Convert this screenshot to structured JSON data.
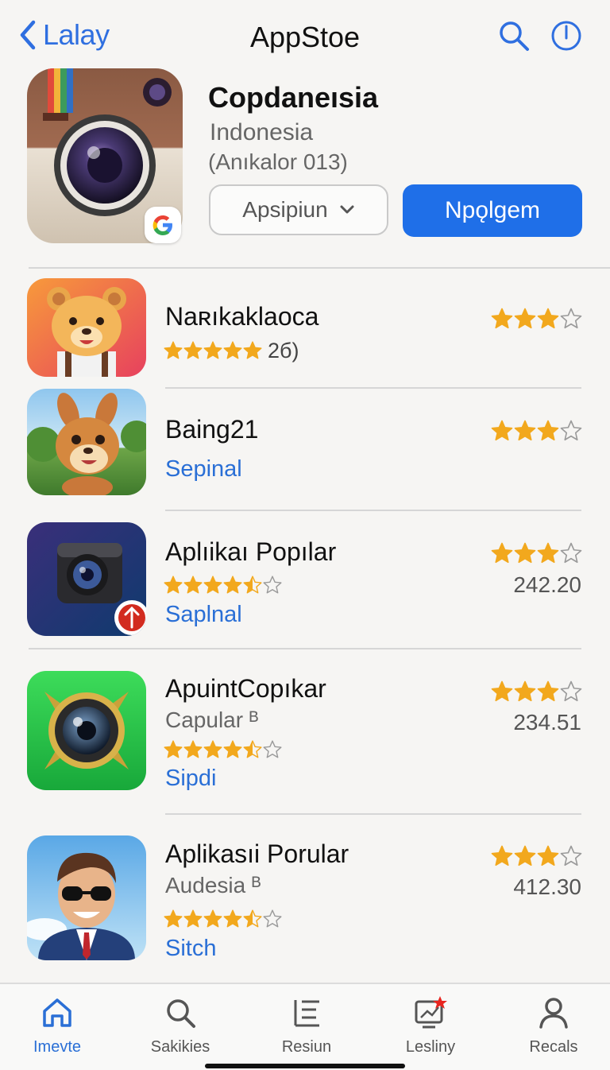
{
  "header": {
    "back_label": "Lalay",
    "title": "AppStoe"
  },
  "featured": {
    "name": "Copdaneısia",
    "country": "Indonesia",
    "meta": "(Anıkalor 013)",
    "dropdown_label": "Apsipiun",
    "primary_button": "Npǫlgem"
  },
  "apps": [
    {
      "name": "Naʀıkaklaoca",
      "left_stars": 5,
      "left_count": "2б)",
      "right_stars": 3
    },
    {
      "name": "Baing21",
      "link": "Sepinal",
      "right_stars": 3
    },
    {
      "name": "Aplıikaı Popılar",
      "left_stars": 4.5,
      "link": "Saplnal",
      "right_stars": 3,
      "price": "242.20"
    },
    {
      "name": "ApuintCopıkar",
      "subtitle": "Capular ᴮ",
      "left_stars": 4.5,
      "link": "Sipdi",
      "right_stars": 3,
      "price": "234.51"
    },
    {
      "name": "Aplikasıi Porular",
      "subtitle": "Audesia ᴮ",
      "left_stars": 4.5,
      "link": "Sitch",
      "right_stars": 3,
      "price": "412.30"
    }
  ],
  "tabs": [
    {
      "label": "Imevte",
      "icon": "home-icon",
      "active": true
    },
    {
      "label": "Sakikies",
      "icon": "search-icon"
    },
    {
      "label": "Resiun",
      "icon": "list-icon"
    },
    {
      "label": "Lesliny",
      "icon": "updates-icon"
    },
    {
      "label": "Recals",
      "icon": "profile-icon"
    }
  ],
  "colors": {
    "accent": "#1f6fe8",
    "star": "#f2a81d"
  }
}
